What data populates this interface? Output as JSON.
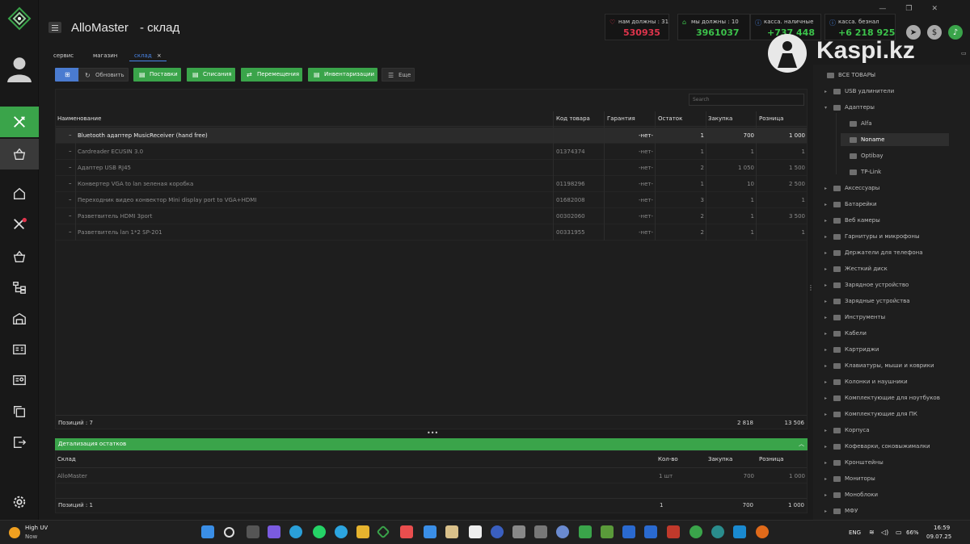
{
  "app": {
    "title": "AlloMaster",
    "subtitle": "- склад"
  },
  "kpis": [
    {
      "label": "нам должны :  31",
      "value": "530935",
      "color": "#e0344c"
    },
    {
      "label": "мы должны :  10",
      "value": "3961037",
      "color": "#3cc24b"
    },
    {
      "label": "касса. наличные",
      "value": "+737 448",
      "color": "#3cc24b"
    },
    {
      "label": "касса. безнал",
      "value": "+6 218 925",
      "color": "#3cc24b"
    }
  ],
  "overlay": {
    "text": "Kaspi.kz"
  },
  "tabs": [
    {
      "label": "сервис"
    },
    {
      "label": "магазин"
    },
    {
      "label": "склад",
      "active": true,
      "close": "×"
    }
  ],
  "toolbar": {
    "refresh": "Обновить",
    "supplies": "Поставки",
    "writeoffs": "Списания",
    "moves": "Перемещения",
    "inventory": "Инвентаризации",
    "more": "Еще"
  },
  "search": {
    "placeholder": "Search"
  },
  "table": {
    "columns": [
      "Наименование",
      "Код товара",
      "Гарантия",
      "Остаток",
      "Закупка",
      "Розница"
    ],
    "rows": [
      {
        "name": "Bluetooth адаптер MusicReceiver (hand free)",
        "code": "",
        "warranty": "-нет-",
        "stock": "1",
        "purchase": "700",
        "retail": "1 000",
        "selected": true
      },
      {
        "name": "Cardreader ECUSIN 3.0",
        "code": "01374374",
        "warranty": "-нет-",
        "stock": "1",
        "purchase": "1",
        "retail": "1"
      },
      {
        "name": "Адаптер USB RJ45",
        "code": "",
        "warranty": "-нет-",
        "stock": "2",
        "purchase": "1 050",
        "retail": "1 500"
      },
      {
        "name": "Конвертер VGA to lan зеленая коробка",
        "code": "01198296",
        "warranty": "-нет-",
        "stock": "1",
        "purchase": "10",
        "retail": "2 500"
      },
      {
        "name": "Переходник видео конвектор Mini display port to VGA+HDMI",
        "code": "01682008",
        "warranty": "-нет-",
        "stock": "3",
        "purchase": "1",
        "retail": "1"
      },
      {
        "name": "Разветвитель HDMI 3port",
        "code": "00302060",
        "warranty": "-нет-",
        "stock": "2",
        "purchase": "1",
        "retail": "3 500"
      },
      {
        "name": "Разветвитель lan 1*2 SP-201",
        "code": "00331955",
        "warranty": "-нет-",
        "stock": "2",
        "purchase": "1",
        "retail": "1"
      }
    ],
    "footer": {
      "count": "Позиций :  7",
      "purchase_total": "2 818",
      "retail_total": "13 506"
    }
  },
  "detail": {
    "title": "Детализация остатков",
    "columns": [
      "Склад",
      "Кол-во",
      "Закупка",
      "Розница"
    ],
    "row": {
      "warehouse": "AlloMaster",
      "qty": "1 шт",
      "purchase": "700",
      "retail": "1 000"
    },
    "footer": {
      "count": "Позиций :  1",
      "qty": "1",
      "purchase": "700",
      "retail": "1 000"
    }
  },
  "tree": [
    {
      "label": "ВСЕ ТОВАРЫ",
      "level": 0,
      "caret": ""
    },
    {
      "label": "USB удлинители",
      "level": 1,
      "caret": "▸"
    },
    {
      "label": "Адаптеры",
      "level": 1,
      "caret": "▾"
    },
    {
      "label": "Alfa",
      "level": 2,
      "caret": ""
    },
    {
      "label": "Noname",
      "level": 2,
      "caret": "",
      "selected": true
    },
    {
      "label": "Optibay",
      "level": 2,
      "caret": ""
    },
    {
      "label": "TP-Link",
      "level": 2,
      "caret": ""
    },
    {
      "label": "Аксессуары",
      "level": 1,
      "caret": "▸"
    },
    {
      "label": "Батарейки",
      "level": 1,
      "caret": "▸"
    },
    {
      "label": "Веб камеры",
      "level": 1,
      "caret": "▸"
    },
    {
      "label": "Гарнитуры и микрофоны",
      "level": 1,
      "caret": "▸"
    },
    {
      "label": "Держатели для телефона",
      "level": 1,
      "caret": "▸"
    },
    {
      "label": "Жесткий диск",
      "level": 1,
      "caret": "▸"
    },
    {
      "label": "Зарядное устройство",
      "level": 1,
      "caret": "▸"
    },
    {
      "label": "Зарядные устройства",
      "level": 1,
      "caret": "▸"
    },
    {
      "label": "Инструменты",
      "level": 1,
      "caret": "▸"
    },
    {
      "label": "Кабели",
      "level": 1,
      "caret": "▸"
    },
    {
      "label": "Картриджи",
      "level": 1,
      "caret": "▸"
    },
    {
      "label": "Клавиатуры, мыши и коврики",
      "level": 1,
      "caret": "▸"
    },
    {
      "label": "Колонки и наушники",
      "level": 1,
      "caret": "▸"
    },
    {
      "label": "Комплектующие для ноутбуков",
      "level": 1,
      "caret": "▸"
    },
    {
      "label": "Комплектующие для ПК",
      "level": 1,
      "caret": "▸"
    },
    {
      "label": "Корпуса",
      "level": 1,
      "caret": "▸"
    },
    {
      "label": "Кофеварки, соковыжималки",
      "level": 1,
      "caret": "▸"
    },
    {
      "label": "Кронштейны",
      "level": 1,
      "caret": "▸"
    },
    {
      "label": "Мониторы",
      "level": 1,
      "caret": "▸"
    },
    {
      "label": "Моноблоки",
      "level": 1,
      "caret": "▸"
    },
    {
      "label": "МФУ",
      "level": 1,
      "caret": "▸"
    }
  ],
  "taskbar": {
    "weather_title": "High UV",
    "weather_sub": "Now",
    "lang": "ENG",
    "battery": "66%",
    "time": "16:59",
    "date": "09.07.25"
  },
  "colors": {
    "accent": "#3aa44a",
    "danger": "#e0344c",
    "tab_active": "#4a86e8"
  }
}
